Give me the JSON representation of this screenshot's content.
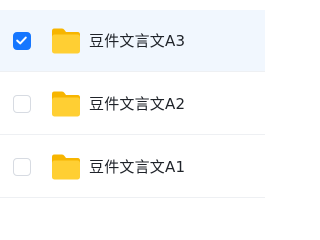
{
  "files": [
    {
      "name": "豆件文言文A3",
      "selected": true,
      "icon": "folder-icon"
    },
    {
      "name": "豆件文言文A2",
      "selected": false,
      "icon": "folder-icon"
    },
    {
      "name": "豆件文言文A1",
      "selected": false,
      "icon": "folder-icon"
    }
  ],
  "colors": {
    "selected_row_bg": "#f1f7fe",
    "checkbox_checked": "#1677ff",
    "folder_body": "#ffcf33",
    "folder_tab": "#f7b500"
  }
}
